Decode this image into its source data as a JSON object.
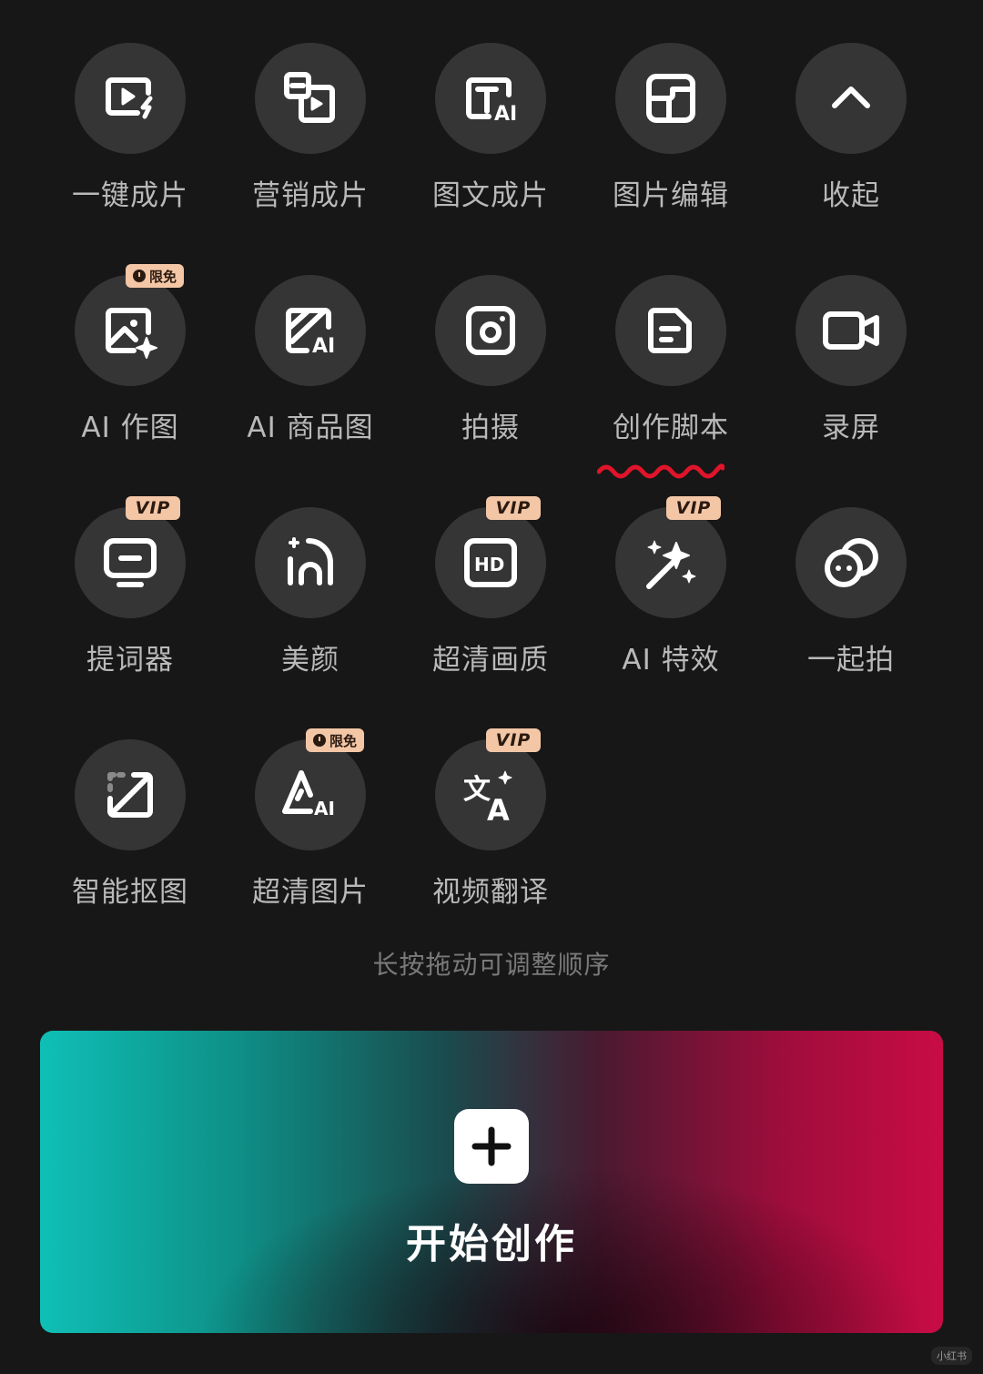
{
  "tools": [
    {
      "label": "一键成片",
      "icon": "quick-video-icon",
      "badge": ""
    },
    {
      "label": "营销成片",
      "icon": "marketing-video-icon",
      "badge": ""
    },
    {
      "label": "图文成片",
      "icon": "text-to-video-icon",
      "badge": ""
    },
    {
      "label": "图片编辑",
      "icon": "image-edit-icon",
      "badge": ""
    },
    {
      "label": "收起",
      "icon": "chevron-up-icon",
      "badge": ""
    },
    {
      "label": "AI 作图",
      "icon": "ai-image-icon",
      "badge": "限免"
    },
    {
      "label": "AI 商品图",
      "icon": "ai-product-image-icon",
      "badge": ""
    },
    {
      "label": "拍摄",
      "icon": "camera-icon",
      "badge": ""
    },
    {
      "label": "创作脚本",
      "icon": "script-icon",
      "badge": ""
    },
    {
      "label": "录屏",
      "icon": "screen-record-icon",
      "badge": ""
    },
    {
      "label": "提词器",
      "icon": "teleprompter-icon",
      "badge": "VIP"
    },
    {
      "label": "美颜",
      "icon": "beauty-icon",
      "badge": ""
    },
    {
      "label": "超清画质",
      "icon": "hd-quality-icon",
      "badge": "VIP"
    },
    {
      "label": "AI 特效",
      "icon": "ai-effects-icon",
      "badge": "VIP"
    },
    {
      "label": "一起拍",
      "icon": "shoot-together-icon",
      "badge": ""
    },
    {
      "label": "智能抠图",
      "icon": "smart-cutout-icon",
      "badge": ""
    },
    {
      "label": "超清图片",
      "icon": "hd-image-icon",
      "badge": "限免"
    },
    {
      "label": "视频翻译",
      "icon": "video-translate-icon",
      "badge": "VIP"
    }
  ],
  "hint": "长按拖动可调整顺序",
  "create": {
    "label": "开始创作",
    "icon": "plus-icon"
  },
  "annotation": {
    "color": "#e0142a"
  },
  "watermark": "小红书",
  "colors": {
    "background": "#171717",
    "icon_circle": "#353535",
    "badge": "#f3c6a6",
    "gradient_left": "#0fbfb6",
    "gradient_right": "#c80c45"
  }
}
